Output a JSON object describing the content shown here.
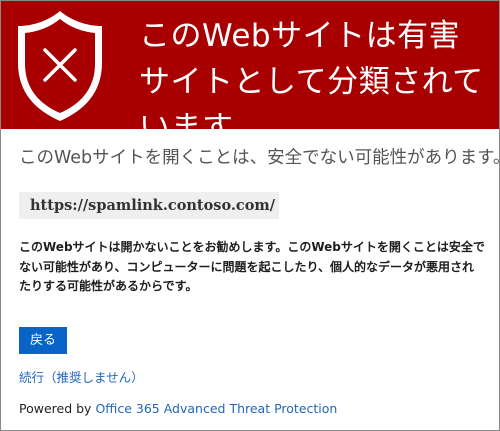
{
  "banner": {
    "title": "このWebサイトは有害サイトとして分類されています。",
    "color": "#a80000",
    "icon": "shield-x-icon"
  },
  "main": {
    "subtitle": "このWebサイトを開くことは、安全でない可能性があります。",
    "url": "https://spamlink.contoso.com/",
    "message": "このWebサイトは開かないことをお勧めします。このWebサイトを開くことは安全でない可能性があり、コンピューターに問題を起こしたり、個人的なデータが悪用されたりする可能性があるからです。",
    "back_label": "戻る",
    "continue_label": "続行（推奨しません）",
    "powered_prefix": "Powered by",
    "powered_link": "Office 365 Advanced Threat Protection"
  },
  "colors": {
    "button": "#0a64c8",
    "link": "#2266bb"
  }
}
